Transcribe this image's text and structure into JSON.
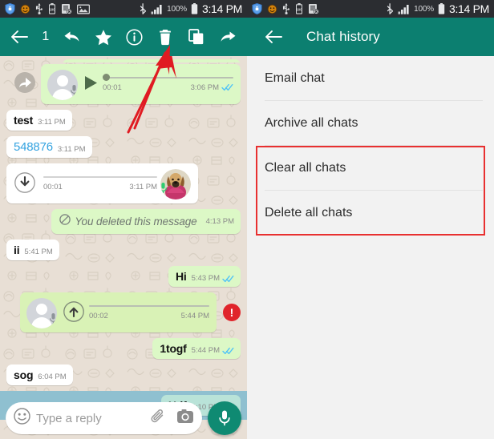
{
  "status_bar": {
    "icons_left": [
      "shield-icon",
      "emoji-icon",
      "usb-icon",
      "battery-saver-icon",
      "document-x-icon",
      "image-icon"
    ],
    "icons_left_right_panel": [
      "shield-icon",
      "emoji-icon",
      "usb-icon",
      "battery-saver-icon",
      "document-x-icon"
    ],
    "bluetooth": "bluetooth-icon",
    "signal": "signal-bars-icon",
    "battery_percent": "100%",
    "battery": "battery-icon",
    "time": "3:14 PM"
  },
  "left_screen": {
    "toolbar": {
      "back": "back-arrow-icon",
      "selected_count": "1",
      "reply": "reply-icon",
      "star": "star-icon",
      "info": "info-icon",
      "delete": "trash-icon",
      "copy": "copy-icon",
      "forward": "forward-icon"
    },
    "messages": [
      {
        "id": "voice-out-1",
        "kind": "voice",
        "side": "out",
        "forwarded": true,
        "duration": "00:01",
        "time": "3:06 PM",
        "ticks": "read",
        "state": "play"
      },
      {
        "id": "text-in-test",
        "kind": "text",
        "side": "in",
        "text": "test",
        "time": "3:11 PM"
      },
      {
        "id": "text-in-number",
        "kind": "link",
        "side": "in",
        "text": "548876",
        "time": "3:11 PM"
      },
      {
        "id": "voice-in-1",
        "kind": "voice",
        "side": "in",
        "duration": "00:01",
        "time": "3:11 PM",
        "state": "download",
        "avatar": "dog-avatar"
      },
      {
        "id": "deleted-out",
        "kind": "deleted",
        "side": "out",
        "text": "You deleted this message",
        "time": "4:13 PM"
      },
      {
        "id": "text-in-ii",
        "kind": "text",
        "side": "in",
        "text": "ii",
        "time": "5:41 PM"
      },
      {
        "id": "text-out-hi",
        "kind": "text",
        "side": "out",
        "text": "Hi",
        "time": "5:43 PM",
        "ticks": "read"
      },
      {
        "id": "voice-out-2",
        "kind": "voice",
        "side": "out",
        "selected": true,
        "duration": "00:02",
        "time": "5:44 PM",
        "state": "upload",
        "error": "!"
      },
      {
        "id": "text-out-1togf",
        "kind": "text",
        "side": "out",
        "text": "1togf",
        "time": "5:44 PM",
        "ticks": "read"
      },
      {
        "id": "text-in-sog",
        "kind": "text",
        "side": "in",
        "text": "sog",
        "time": "6:04 PM"
      },
      {
        "id": "text-out-hdf",
        "kind": "text",
        "side": "out",
        "text": "Hdf",
        "time": "6:10 PM",
        "ticks": "read",
        "highlighted": true
      }
    ],
    "input_bar": {
      "emoji": "emoji-icon",
      "placeholder": "Type a reply",
      "attach": "paperclip-icon",
      "camera": "camera-icon",
      "mic": "mic-icon"
    }
  },
  "right_screen": {
    "toolbar": {
      "back": "back-arrow-icon",
      "title": "Chat history"
    },
    "menu_items": [
      {
        "label": "Email chat",
        "highlighted": false
      },
      {
        "label": "Archive all chats",
        "highlighted": false
      },
      {
        "label": "Clear all chats",
        "highlighted": true
      },
      {
        "label": "Delete all chats",
        "highlighted": true
      }
    ]
  },
  "annotations": {
    "arrow_color": "#e01b22",
    "highlight_color": "#e83030",
    "target": "trash-icon"
  },
  "colors": {
    "appbar": "#0c7f70",
    "out_bubble": "#dcf8c6",
    "in_bubble": "#ffffff",
    "selection_band": "#8fc0d0",
    "fab": "#0f8a72",
    "link": "#34a3e0",
    "tick": "#4fc3f7",
    "error": "#e0242b"
  }
}
